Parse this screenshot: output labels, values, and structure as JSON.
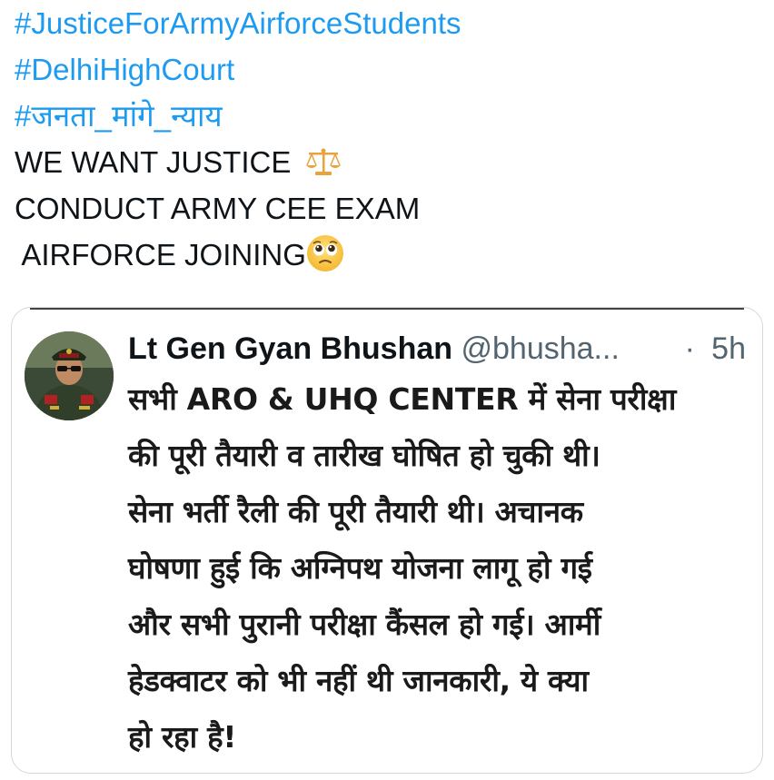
{
  "tweet": {
    "hashtags": [
      "#JusticeForArmyAirforceStudents",
      "#DelhiHighCourt",
      "#जनता_मांगे_न्याय"
    ],
    "lines": [
      "WE WANT JUSTICE",
      "CONDUCT ARMY CEE EXAM",
      " AIRFORCE JOINING"
    ],
    "emojis": [
      "scales-emoji",
      "face-holding-back-tears-emoji"
    ]
  },
  "quoted_tweet": {
    "author_name": "Lt Gen Gyan Bhushan",
    "author_handle": "@bhusha...",
    "separator": "·",
    "time": "5h",
    "body_lines": [
      "सभी ARO & UHQ CENTER में सेना परीक्षा",
      "की पूरी तैयारी व तारीख घोषित हो चुकी थी।",
      "सेना भर्ती रैली की पूरी तैयारी थी। अचानक",
      "घोषणा हुई कि अग्निपथ योजना लागू हो गई",
      "और सभी पुरानी परीक्षा कैंसल हो गई। आर्मी",
      "हेडक्वाटर को भी नहीं थी जानकारी, ये क्या",
      "हो रहा है!"
    ]
  },
  "colors": {
    "hashtag": "#1d9bf0",
    "text": "#0f1419",
    "muted": "#536471",
    "border": "#cfd9de"
  }
}
